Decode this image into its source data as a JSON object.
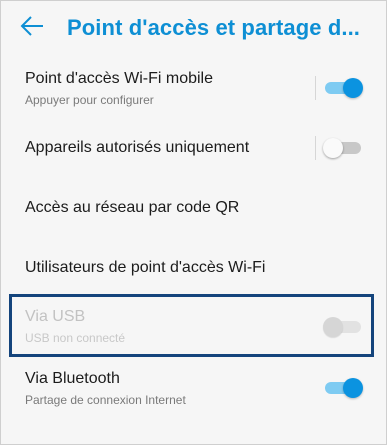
{
  "header": {
    "title": "Point d'accès et partage d...",
    "back_icon": "arrow-left-icon"
  },
  "items": [
    {
      "label": "Point d'accès Wi-Fi mobile",
      "sub": "Appuyer pour configurer",
      "toggle": "on"
    },
    {
      "label": "Appareils autorisés uniquement",
      "toggle": "off"
    },
    {
      "label": "Accès au réseau par code QR"
    },
    {
      "label": "Utilisateurs de point d'accès Wi-Fi"
    },
    {
      "label": "Via USB",
      "sub": "USB non connecté",
      "toggle": "off",
      "disabled": true
    },
    {
      "label": "Via Bluetooth",
      "sub": "Partage de connexion Internet",
      "toggle": "on"
    }
  ],
  "colors": {
    "accent": "#0e8fd4",
    "highlight_border": "#14447c"
  }
}
